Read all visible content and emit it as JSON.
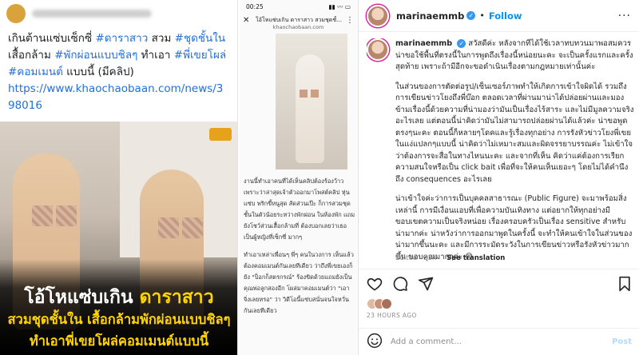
{
  "panel_facebook": {
    "post_text": {
      "segments": [
        {
          "text": "เกินต้านแซ่บเซ็กซี่ ",
          "tag": false
        },
        {
          "text": "#ดาราสาว",
          "tag": true
        },
        {
          "text": " สวม ",
          "tag": false
        },
        {
          "text": "#ชุดชั้นใน",
          "tag": true
        },
        {
          "text": " เสื้อกล้าม ",
          "tag": false
        },
        {
          "text": "#พักผ่อนแบบชิลๆ",
          "tag": true
        },
        {
          "text": " ทำเอา ",
          "tag": false
        },
        {
          "text": "#พี่เขยโผล่",
          "tag": true
        },
        {
          "text": " ",
          "tag": false
        },
        {
          "text": "#คอมเมนต์",
          "tag": true
        },
        {
          "text": " แบบนี้ (มีคลิป)",
          "tag": false
        }
      ],
      "link": "https://www.khaochaobaan.com/news/398016"
    },
    "headline": {
      "line1_white": "โอ้โหแซ่บเกิน",
      "line1_yellow": "ดาราสาว",
      "line2": "สวมชุดชั้นใน เสื้อกล้ามพักผ่อนแบบชิลๆ",
      "line3": "ทำเอาพี่เขยโผล่คอมเมนต์แบบนี้"
    }
  },
  "panel_phone": {
    "status_time": "00:25",
    "status_right": "▮▮ 〰 ▭",
    "page_title": "โอ้โหแซ่บเกิน ดาราสาว สวมชุดชั้นใน เสื้อกล้ามพักผ่อนแบบชิลๆ",
    "domain": "khaochaobaan.com",
    "paragraphs": [
      "งานนี้ทำเอาคนที่ได้เห็นคลิปต้องร้องว้าว เพราะว่าล่าสุดเจ้าตัวออกมาโพสต์คลิป หุ่นแซ่บ พริกขี้หนูสุด สัดส่วนเป๊ะ ก็การสวมชุดชั้นในตัวน้อยระหว่างพักผ่อน ในห้องพัก แถมยังโชว์ส่วนเสื้อกล้ามที่ ต้องบอกเลยว่าเธอเป็นผู้หญิงที่เซ็กซี่ มากๆ",
      "ทำเอาเหล่าเพื่อนๆ พี่ๆ คนในวงการ เห็นแล้วต้องคอมเมนต์กันเลยทีเดียว ว่าถึงพี่เขยเองก็ยัง \"ป็อกก็สตรกรณ์\" ร้องขิดด้วยแถมยังเป็นคุณพ่อลูกสองอีก โผล่มาคอมเมนต์ว่า \"เอาจิ่งเลยหรอ\" ว่า วิดีโอนี้แซ่บสนั่นจนใจหวั่นกันเลยทีเดียว"
    ]
  },
  "panel_instagram": {
    "username": "marinaemmb",
    "follow_label": "Follow",
    "caption_paragraphs": [
      "สวัสดีค่ะ หลังจากที่ได้ใช้เวลาทบทวนมาพอสมควร น่าขอใช้พื้นที่ตรงนี้ในการพูดถึงเรื่องนี้หน่อยนะคะ จะเป็นครั้งแรกและครั้งสุดท้าย เพราะถ้ามีอีกจะขอดำเนินเรื่องตามกฎหมายเท่านั้นค่ะ",
      "ในส่วนของการตัดต่อรูป/เซ็นเซอร์ภาพทำให้เกิดการเข้าใจผิดได้ รวมถึงการเขียนข่าวโยงถึงพี่บ๊อก ตลอดเวลาที่ผ่านมาน่าได้ปล่อยผ่านและมองข้ามเรื่องนี้ด้วยความที่น่ามองว่ามันเป็นเรื่องไร้สาระ และไม่มีมูลความจริงอะไรเลย แต่ตอนนี้น่าคิดว่ามันไม่สามารถปล่อยผ่านได้แล้วค่ะ น่าขอพูดตรงๆนะคะ ตอนนี้ก็หลายๆโดคและรู้เรื่องทุกอย่าง การรังหัวข่าวโยงพี่เขยในแง่แปลกๆแบบนี้ น่าคิดว่าไม่เหมาะสมและผิดจรรยาบรรณค่ะ ไม่เข้าใจว่าต้องการจะสื่อในทางไหนนะคะ และจากที่เห็น คิดว่าแค่ต้องการเรียกความสนใจหรือเป็น click bait เพื่อที่จะให้คนเห็นเยอะๆ โดยไม่ได้คำนึงถึง consequences อะไรเลย",
      "น่าเข้าใจค่ะว่าการเป็นบุคคลสาธารณะ (Public Figure) จะมาพร้อมสิ่งเหล่านี้ การมีเงื่อนแอบที่เพื่อความบันเทิงทาง แต่อยากให้ทุกอย่างมีขอบเขตความเป็นจริงหน่อย เรื่องครอบครัวเป็นเรื่อง sensitive สำหรับน่ามากค่ะ น่าหวังว่าการออกมาพูดในครั้งนี้ จะทำให้คนเข้าใจในส่วนของน่ามากขึ้นนะคะ และมีการระมัดระวังในการเขียนข่าวหรือรังหัวข่าวมากขึ้น ขอบคุณมากๆค่ะ 😊"
    ],
    "edited": "Edited · 23h",
    "see_translation": "See translation",
    "time_ago": "23 HOURS AGO",
    "comment_placeholder": "Add a comment...",
    "post_label": "Post",
    "colors": {
      "link_blue": "#0095f6",
      "verified": "#3897f0"
    }
  }
}
